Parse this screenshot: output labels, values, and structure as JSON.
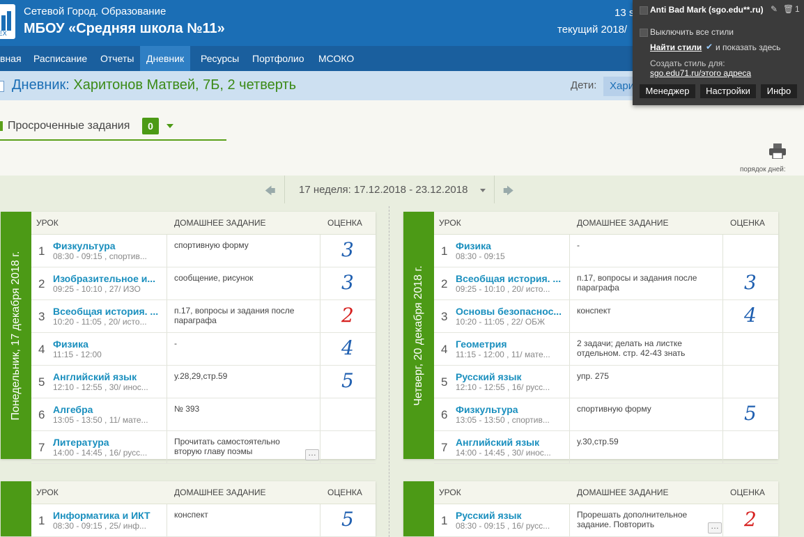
{
  "header": {
    "org": "Сетевой Город. Образование",
    "school": "МБОУ «Средняя школа №11»",
    "right_top": "13 s",
    "right_bottom": "текущий 2018/",
    "logo_text": "EX"
  },
  "nav": [
    "вная",
    "Расписание",
    "Отчеты",
    "Дневник",
    "Ресурсы",
    "Портфолио",
    "МСОКО"
  ],
  "nav_active": "Дневник",
  "title": {
    "prefix": "Дневник: ",
    "name": "Харитонов Матвей, 7Б, 2 четверть",
    "kids_label": "Дети:",
    "kids_value": "Хари"
  },
  "overdue": {
    "label": "Просроченные задания",
    "count": "0"
  },
  "order_label": "порядок дней:",
  "order_icon": [
    "1 2 4",
    "2 5",
    "3 6"
  ],
  "week": {
    "label": "17 неделя: 17.12.2018 - 23.12.2018"
  },
  "table_headers": {
    "lesson": "УРОК",
    "homework": "ДОМАШНЕЕ ЗАДАНИЕ",
    "grade": "ОЦЕНКА"
  },
  "colors": {
    "grade_good": "#1f5fb0",
    "grade_bad": "#d6201f",
    "day_green": "#4c9a16"
  },
  "days": [
    {
      "label": "Понедельник, 17 декабря 2018 г.",
      "lessons": [
        {
          "n": "1",
          "subject": "Физкультура",
          "time": "08:30 - 09:15 , спортив...",
          "hw": "спортивную форму",
          "grade": "3",
          "bad": false,
          "more": false
        },
        {
          "n": "2",
          "subject": "Изобразительное и...",
          "time": "09:25 - 10:10 , 27/ ИЗО",
          "hw": "сообщение, рисунок",
          "grade": "3",
          "bad": false,
          "more": false
        },
        {
          "n": "3",
          "subject": "Всеобщая история. ...",
          "time": "10:20 - 11:05 , 20/ исто...",
          "hw": "п.17, вопросы и задания после параграфа",
          "grade": "2",
          "bad": true,
          "more": false
        },
        {
          "n": "4",
          "subject": "Физика",
          "time": "11:15 - 12:00",
          "hw": "-",
          "grade": "4",
          "bad": false,
          "more": false
        },
        {
          "n": "5",
          "subject": "Английский язык",
          "time": "12:10 - 12:55 , 30/ инос...",
          "hw": "у.28,29,стр.59",
          "grade": "5",
          "bad": false,
          "more": false
        },
        {
          "n": "6",
          "subject": "Алгебра",
          "time": "13:05 - 13:50 , 11/ мате...",
          "hw": "№ 393",
          "grade": "",
          "bad": false,
          "more": false
        },
        {
          "n": "7",
          "subject": "Литература",
          "time": "14:00 - 14:45 , 16/ русс...",
          "hw": "Прочитать самостоятельно вторую главу поэмы",
          "grade": "",
          "bad": false,
          "more": true
        }
      ]
    },
    {
      "label": "Четверг, 20 декабря 2018 г.",
      "lessons": [
        {
          "n": "1",
          "subject": "Физика",
          "time": "08:30 - 09:15",
          "hw": "-",
          "grade": "",
          "bad": false,
          "more": false
        },
        {
          "n": "2",
          "subject": "Всеобщая история. ...",
          "time": "09:25 - 10:10 , 20/ исто...",
          "hw": "п.17, вопросы и задания после параграфа",
          "grade": "3",
          "bad": false,
          "more": false
        },
        {
          "n": "3",
          "subject": "Основы безопаснос...",
          "time": "10:20 - 11:05 , 22/ ОБЖ",
          "hw": "конспект",
          "grade": "4",
          "bad": false,
          "more": false
        },
        {
          "n": "4",
          "subject": "Геометрия",
          "time": "11:15 - 12:00 , 11/ мате...",
          "hw": "2 задачи; делать на листке отдельном. стр. 42-43 знать",
          "grade": "",
          "bad": false,
          "more": false
        },
        {
          "n": "5",
          "subject": "Русский язык",
          "time": "12:10 - 12:55 , 16/ русс...",
          "hw": "упр. 275",
          "grade": "",
          "bad": false,
          "more": false
        },
        {
          "n": "6",
          "subject": "Физкультура",
          "time": "13:05 - 13:50 , спортив...",
          "hw": "спортивную форму",
          "grade": "5",
          "bad": false,
          "more": false
        },
        {
          "n": "7",
          "subject": "Английский язык",
          "time": "14:00 - 14:45 , 30/ инос...",
          "hw": "у.30,стр.59",
          "grade": "",
          "bad": false,
          "more": false
        }
      ]
    },
    {
      "label": "",
      "lessons": [
        {
          "n": "1",
          "subject": "Информатика и ИКТ",
          "time": "08:30 - 09:15 , 25/ инф...",
          "hw": "конспект",
          "grade": "5",
          "bad": false,
          "more": false
        }
      ]
    },
    {
      "label": "",
      "lessons": [
        {
          "n": "1",
          "subject": "Русский язык",
          "time": "08:30 - 09:15 , 16/ русс...",
          "hw": "Прорешать дополнительное задание. Повторить",
          "grade": "2",
          "bad": true,
          "more": true
        }
      ]
    }
  ],
  "extension": {
    "title": "Anti Bad Mark (sgo.edu**.ru)",
    "count": "1",
    "disable_all": "Выключить все стили",
    "find_styles": "Найти стили",
    "show_here": "и показать здесь",
    "create_for": "Создать стиль для:",
    "create_link": "sgo.edu71.ru/этого адреса",
    "buttons": [
      "Менеджер",
      "Настройки",
      "Инфо"
    ]
  }
}
